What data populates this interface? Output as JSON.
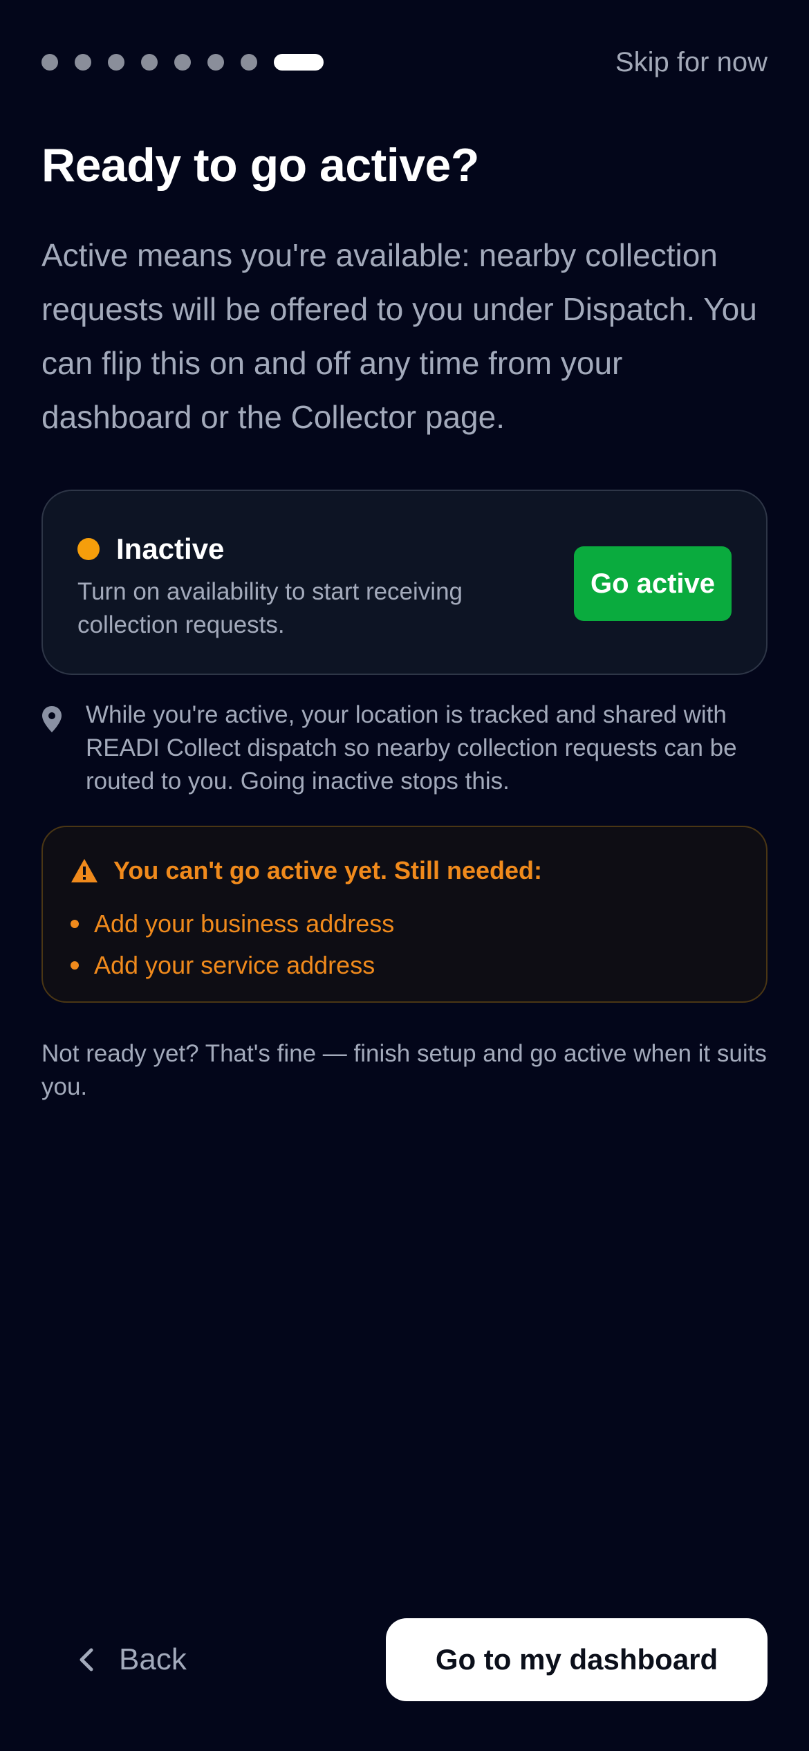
{
  "progress": {
    "steps_total": 8,
    "current_step": 8
  },
  "header": {
    "skip_label": "Skip for now"
  },
  "title": "Ready to go active?",
  "intro": "Active means you're available: nearby collection requests will be offered to you under Dispatch. You can flip this on and off any time from your dashboard or the Collector page.",
  "status_card": {
    "status": "Inactive",
    "status_color": "#f59e0b",
    "description": "Turn on availability to start receiving collection requests.",
    "button_label": "Go active",
    "button_color": "#0aab3e"
  },
  "location_note": {
    "icon": "map-pin-icon",
    "text": "While you're active, your location is tracked and shared with READI Collect dispatch so nearby collection requests can be routed to you. Going inactive stops this."
  },
  "warning": {
    "icon": "warning-triangle-icon",
    "title": "You can't go active yet. Still needed:",
    "color": "#f08a1c",
    "items": [
      "Add your business address",
      "Add your service address"
    ]
  },
  "footer_note": "Not ready yet? That's fine — finish setup and go active when it suits you.",
  "nav": {
    "back_label": "Back",
    "primary_label": "Go to my dashboard"
  }
}
